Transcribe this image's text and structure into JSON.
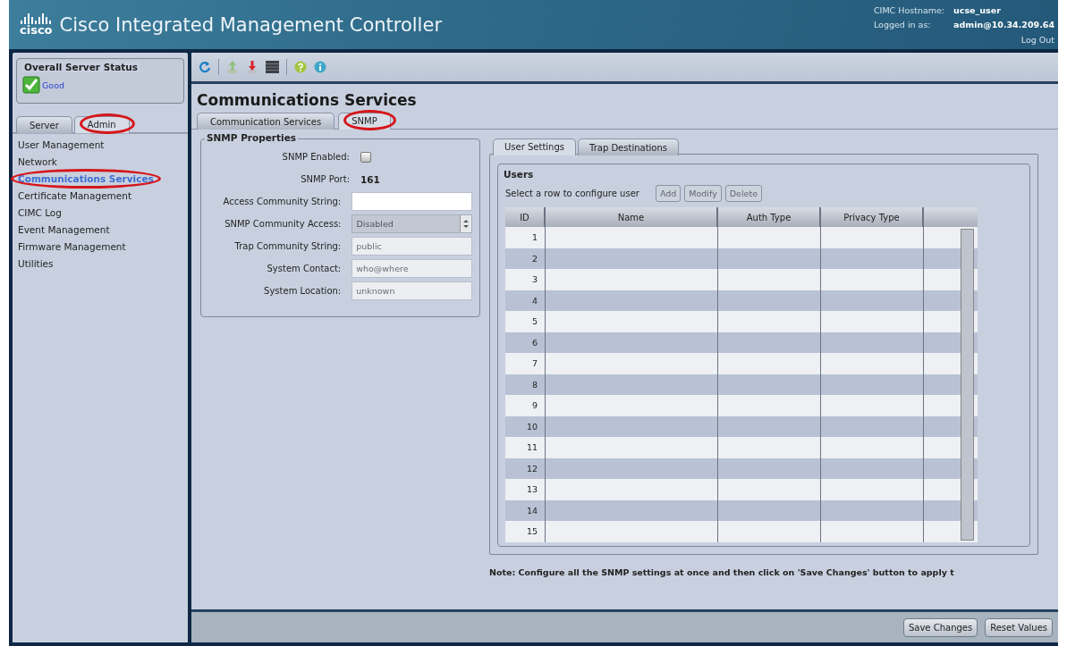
{
  "header": {
    "logo": "cisco",
    "title": "Cisco Integrated Management Controller",
    "hostname_label": "CIMC Hostname:",
    "hostname": "ucse_user",
    "logged_label": "Logged in as:",
    "logged_user": "admin@10.34.209.64",
    "logout": "Log Out"
  },
  "sidebar": {
    "status_title": "Overall Server Status",
    "status": "Good",
    "tabs": [
      {
        "label": "Server",
        "selected": false,
        "circled": false
      },
      {
        "label": "Admin",
        "selected": true,
        "circled": true
      }
    ],
    "items": [
      {
        "label": "User Management",
        "selected": false,
        "circled": false
      },
      {
        "label": "Network",
        "selected": false,
        "circled": false
      },
      {
        "label": "Communications Services",
        "selected": true,
        "circled": true
      },
      {
        "label": "Certificate Management",
        "selected": false,
        "circled": false
      },
      {
        "label": "CIMC Log",
        "selected": false,
        "circled": false
      },
      {
        "label": "Event Management",
        "selected": false,
        "circled": false
      },
      {
        "label": "Firmware Management",
        "selected": false,
        "circled": false
      },
      {
        "label": "Utilities",
        "selected": false,
        "circled": false
      }
    ]
  },
  "main": {
    "page_title": "Communications Services",
    "tabs": [
      {
        "label": "Communication Services",
        "selected": false,
        "circled": false
      },
      {
        "label": "SNMP",
        "selected": true,
        "circled": true
      }
    ],
    "snmp_properties": {
      "title": "SNMP Properties",
      "fields": [
        {
          "label": "SNMP Enabled:",
          "kind": "checkbox",
          "checked": false
        },
        {
          "label": "SNMP Port:",
          "kind": "text",
          "value": "161"
        },
        {
          "label": "Access Community String:",
          "kind": "input",
          "disabled": false
        },
        {
          "label": "SNMP Community Access:",
          "kind": "select",
          "value": "Disabled",
          "disabled": true
        },
        {
          "label": "Trap Community String:",
          "kind": "input",
          "value": "public",
          "disabled": true
        },
        {
          "label": "System Contact:",
          "kind": "input",
          "value": "who@where",
          "disabled": true
        },
        {
          "label": "System Location:",
          "kind": "input",
          "value": "unknown",
          "disabled": true
        }
      ]
    },
    "user_tabs": [
      {
        "label": "User Settings",
        "selected": true
      },
      {
        "label": "Trap Destinations",
        "selected": false
      }
    ],
    "users": {
      "title": "Users",
      "hint": "Select a row to configure user",
      "buttons": [
        {
          "label": "Add",
          "disabled": true
        },
        {
          "label": "Modify",
          "disabled": true
        },
        {
          "label": "Delete",
          "disabled": true
        }
      ],
      "columns": [
        "ID",
        "Name",
        "Auth Type",
        "Privacy Type"
      ],
      "rows": [
        {
          "number": "1"
        },
        {
          "number": "2"
        },
        {
          "number": "3"
        },
        {
          "number": "4"
        },
        {
          "number": "5"
        },
        {
          "number": "6"
        },
        {
          "number": "7"
        },
        {
          "number": "8"
        },
        {
          "number": "9"
        },
        {
          "number": "10"
        },
        {
          "number": "11"
        },
        {
          "number": "12"
        },
        {
          "number": "13"
        },
        {
          "number": "14"
        },
        {
          "number": "15"
        }
      ]
    },
    "note": "Note: Configure all the SNMP settings at once and then click on 'Save Changes' button to apply t",
    "footer_buttons": [
      {
        "label": "Save Changes"
      },
      {
        "label": "Reset Values"
      }
    ]
  }
}
